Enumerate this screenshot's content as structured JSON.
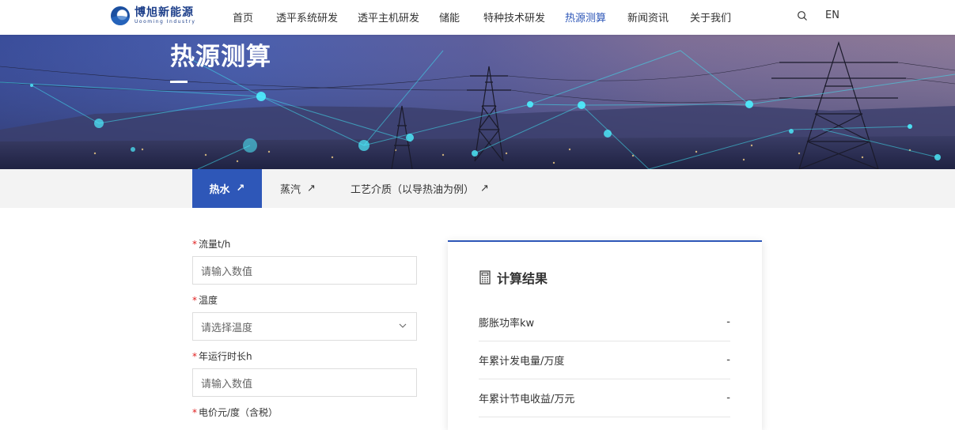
{
  "brand": {
    "name_cn": "博旭新能源",
    "name_en": "Uooming Industry"
  },
  "nav": {
    "items": [
      "首页",
      "透平系统研发",
      "透平主机研发",
      "储能",
      "特种技术研发",
      "热源测算",
      "新闻资讯",
      "关于我们"
    ],
    "active": "热源测算",
    "lang": "EN"
  },
  "banner": {
    "title": "热源测算"
  },
  "tabs": [
    {
      "label": "热水",
      "active": true
    },
    {
      "label": "蒸汽",
      "active": false
    },
    {
      "label": "工艺介质（以导热油为例）",
      "active": false
    }
  ],
  "form": {
    "required_mark": "*",
    "flow": {
      "label": "流量t/h",
      "placeholder": "请输入数值"
    },
    "temperature": {
      "label": "温度",
      "placeholder": "请选择温度"
    },
    "hours": {
      "label": "年运行时长h",
      "placeholder": "请输入数值"
    },
    "price": {
      "label": "电价元/度（含税）"
    }
  },
  "result": {
    "title": "计算结果",
    "rows": [
      {
        "label": "膨胀功率kw",
        "value": "-"
      },
      {
        "label": "年累计发电量/万度",
        "value": "-"
      },
      {
        "label": "年累计节电收益/万元",
        "value": "-"
      }
    ]
  },
  "colors": {
    "accent": "#2e57b8",
    "required": "#e02020",
    "tabs_bg": "#f3f3f3"
  }
}
